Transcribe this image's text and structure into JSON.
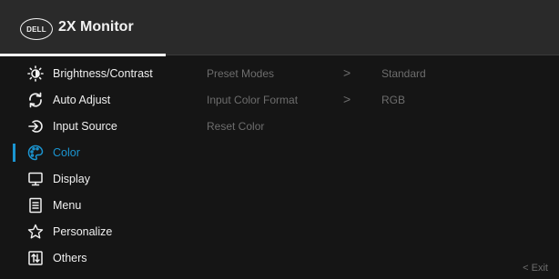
{
  "header": {
    "logo_text": "DELL",
    "title": "2X Monitor"
  },
  "sidebar": {
    "items": [
      {
        "label": "Brightness/Contrast",
        "icon": "brightness-icon"
      },
      {
        "label": "Auto Adjust",
        "icon": "auto-adjust-icon"
      },
      {
        "label": "Input Source",
        "icon": "input-source-icon"
      },
      {
        "label": "Color",
        "icon": "color-palette-icon",
        "active": true
      },
      {
        "label": "Display",
        "icon": "display-icon"
      },
      {
        "label": "Menu",
        "icon": "menu-icon"
      },
      {
        "label": "Personalize",
        "icon": "star-icon"
      },
      {
        "label": "Others",
        "icon": "others-icon"
      }
    ]
  },
  "submenu": {
    "rows": [
      {
        "label": "Preset Modes",
        "arrow": ">",
        "value": "Standard"
      },
      {
        "label": "Input Color Format",
        "arrow": ">",
        "value": "RGB"
      },
      {
        "label": "Reset Color"
      }
    ]
  },
  "footer": {
    "exit_label": "< Exit"
  },
  "colors": {
    "accent": "#1b95d1",
    "header_bg": "#2a2a2a",
    "body_bg": "#151515",
    "dim_text": "#6d6d6d"
  }
}
